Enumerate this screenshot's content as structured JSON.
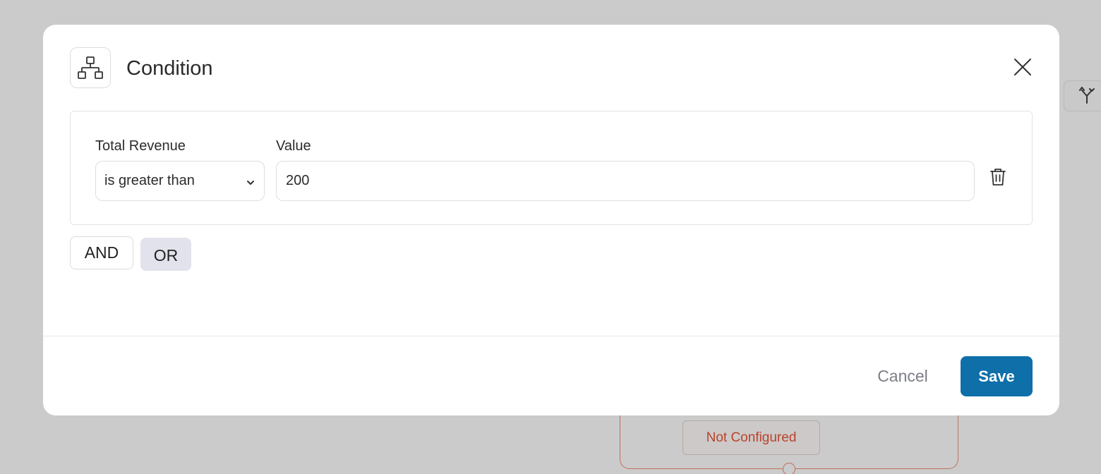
{
  "colors": {
    "overlay": "#cbcbcb",
    "primary": "#0e6fa9",
    "or_active_bg": "#e2e2ec",
    "warning_text": "#b8442c",
    "warning_border": "#c2705c"
  },
  "background": {
    "node_icon": "fork-icon",
    "status_badge": "Not Configured"
  },
  "modal": {
    "icon": "hierarchy-icon",
    "title": "Condition",
    "close_icon": "close-icon",
    "condition": {
      "field_label": "Total Revenue",
      "operator": "is greater than",
      "value_label": "Value",
      "value": "200",
      "delete_icon": "trash-icon"
    },
    "logic": {
      "and_label": "AND",
      "or_label": "OR",
      "selected": "OR"
    },
    "footer": {
      "cancel_label": "Cancel",
      "save_label": "Save"
    }
  }
}
